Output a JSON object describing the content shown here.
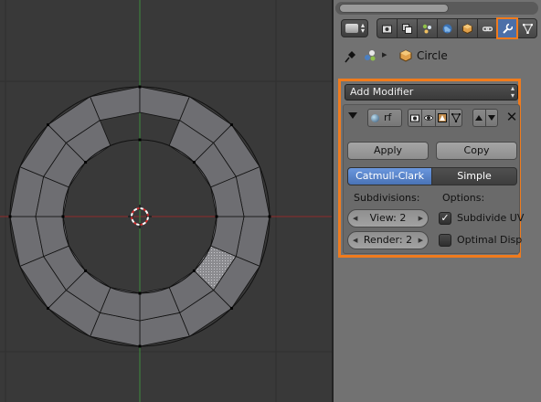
{
  "panel": {
    "breadcrumb_object": "Circle",
    "context_tabs": [
      "render-icon",
      "render-layers-icon",
      "scene-icon",
      "world-icon",
      "object-icon",
      "constraints-icon",
      "modifiers-icon",
      "data-icon"
    ],
    "active_tab": "modifiers-icon"
  },
  "modifiers": {
    "add_label": "Add Modifier",
    "name": "rf",
    "apply_label": "Apply",
    "copy_label": "Copy",
    "mode_active": "Catmull-Clark",
    "mode_other": "Simple",
    "subdivisions_label": "Subdivisions:",
    "options_label": "Options:",
    "view_field": "View: 2",
    "render_field": "Render: 2",
    "subdivide_uv_label": "Subdivide UV",
    "subdivide_uv_checked": true,
    "optimal_display_label": "Optimal Disp",
    "optimal_display_checked": false
  },
  "colors": {
    "highlight": "#f07b1d",
    "active_blue": "#5a84cb",
    "mesh_face": "#6e6e72",
    "x_axis": "#a03030",
    "y_axis": "#3c8c3c"
  }
}
